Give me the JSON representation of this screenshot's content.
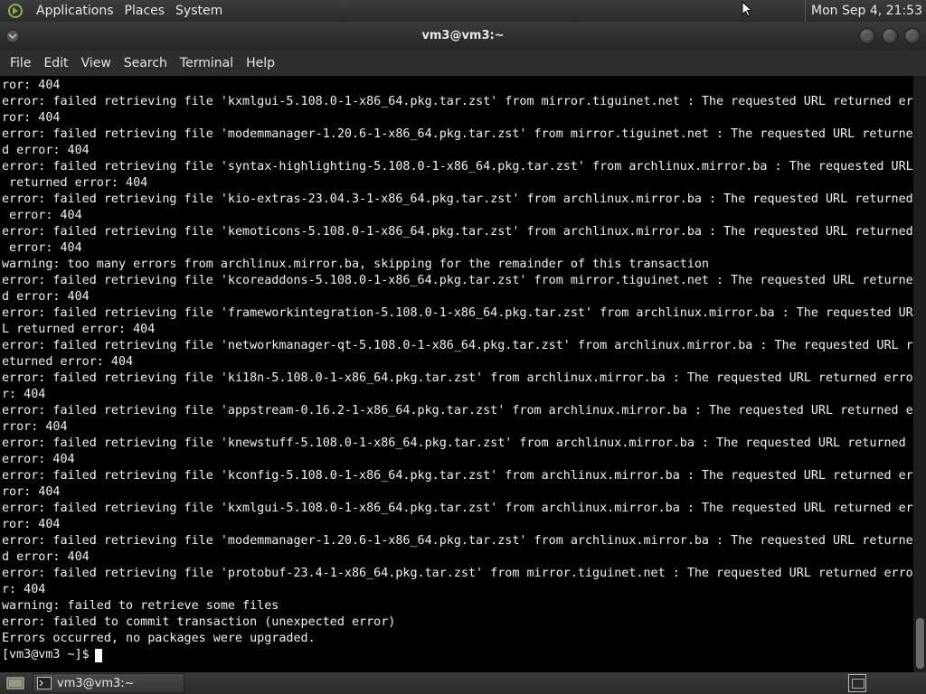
{
  "top_panel": {
    "menus": [
      "Applications",
      "Places",
      "System"
    ],
    "clock": "Mon Sep  4, 21:53"
  },
  "window": {
    "title": "vm3@vm3:~"
  },
  "menubar": {
    "items": [
      "File",
      "Edit",
      "View",
      "Search",
      "Terminal",
      "Help"
    ]
  },
  "terminal": {
    "lines": [
      "ror: 404",
      "error: failed retrieving file 'kxmlgui-5.108.0-1-x86_64.pkg.tar.zst' from mirror.tiguinet.net : The requested URL returned er",
      "ror: 404",
      "error: failed retrieving file 'modemmanager-1.20.6-1-x86_64.pkg.tar.zst' from mirror.tiguinet.net : The requested URL returne",
      "d error: 404",
      "error: failed retrieving file 'syntax-highlighting-5.108.0-1-x86_64.pkg.tar.zst' from archlinux.mirror.ba : The requested URL",
      " returned error: 404",
      "error: failed retrieving file 'kio-extras-23.04.3-1-x86_64.pkg.tar.zst' from archlinux.mirror.ba : The requested URL returned",
      " error: 404",
      "error: failed retrieving file 'kemoticons-5.108.0-1-x86_64.pkg.tar.zst' from archlinux.mirror.ba : The requested URL returned",
      " error: 404",
      "warning: too many errors from archlinux.mirror.ba, skipping for the remainder of this transaction",
      "error: failed retrieving file 'kcoreaddons-5.108.0-1-x86_64.pkg.tar.zst' from mirror.tiguinet.net : The requested URL returne",
      "d error: 404",
      "error: failed retrieving file 'frameworkintegration-5.108.0-1-x86_64.pkg.tar.zst' from archlinux.mirror.ba : The requested UR",
      "L returned error: 404",
      "error: failed retrieving file 'networkmanager-qt-5.108.0-1-x86_64.pkg.tar.zst' from archlinux.mirror.ba : The requested URL r",
      "eturned error: 404",
      "error: failed retrieving file 'ki18n-5.108.0-1-x86_64.pkg.tar.zst' from archlinux.mirror.ba : The requested URL returned erro",
      "r: 404",
      "error: failed retrieving file 'appstream-0.16.2-1-x86_64.pkg.tar.zst' from archlinux.mirror.ba : The requested URL returned e",
      "rror: 404",
      "error: failed retrieving file 'knewstuff-5.108.0-1-x86_64.pkg.tar.zst' from archlinux.mirror.ba : The requested URL returned",
      "error: 404",
      "error: failed retrieving file 'kconfig-5.108.0-1-x86_64.pkg.tar.zst' from archlinux.mirror.ba : The requested URL returned er",
      "ror: 404",
      "error: failed retrieving file 'kxmlgui-5.108.0-1-x86_64.pkg.tar.zst' from archlinux.mirror.ba : The requested URL returned er",
      "ror: 404",
      "error: failed retrieving file 'modemmanager-1.20.6-1-x86_64.pkg.tar.zst' from archlinux.mirror.ba : The requested URL returne",
      "d error: 404",
      "error: failed retrieving file 'protobuf-23.4-1-x86_64.pkg.tar.zst' from mirror.tiguinet.net : The requested URL returned erro",
      "r: 404",
      "warning: failed to retrieve some files",
      "error: failed to commit transaction (unexpected error)",
      "Errors occurred, no packages were upgraded."
    ],
    "prompt": "[vm3@vm3 ~]$"
  },
  "taskbar": {
    "task_label": "vm3@vm3:~"
  }
}
